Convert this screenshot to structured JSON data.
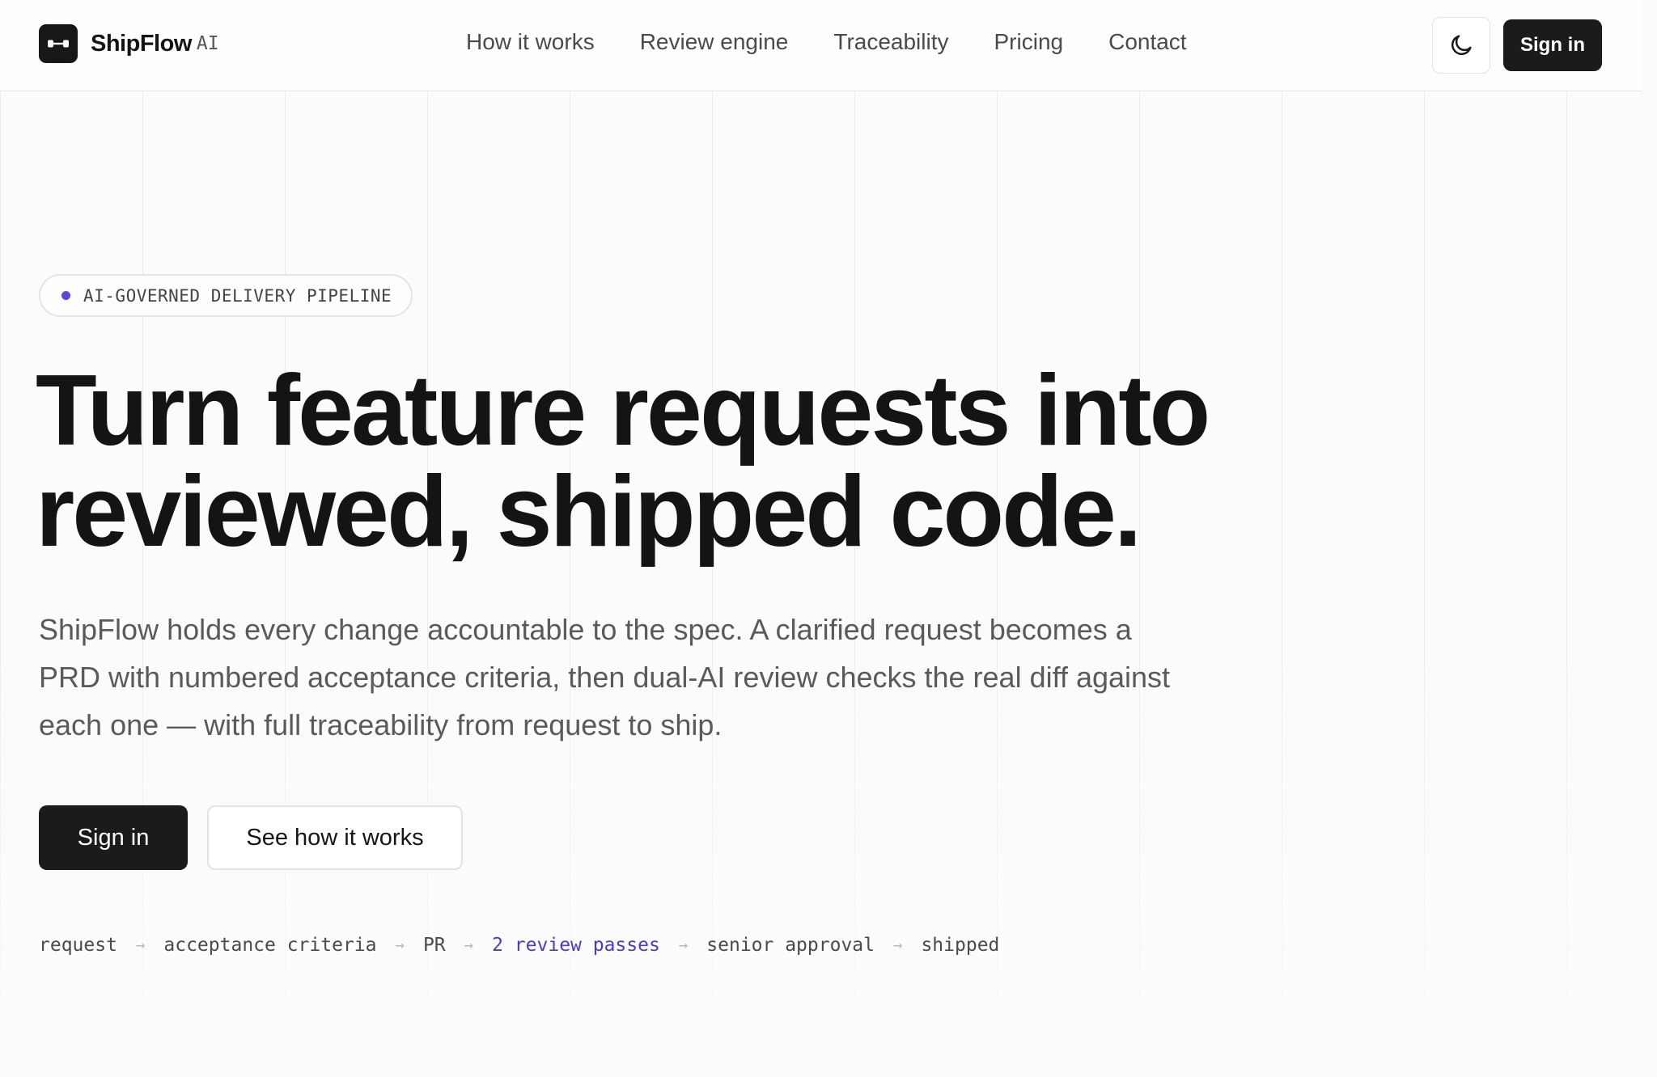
{
  "header": {
    "brand": {
      "name": "ShipFlow",
      "suffix": "AI",
      "logo_icon": "link-icon"
    },
    "nav": [
      {
        "label": "How it works"
      },
      {
        "label": "Review engine"
      },
      {
        "label": "Traceability"
      },
      {
        "label": "Pricing"
      },
      {
        "label": "Contact"
      }
    ],
    "theme_toggle_icon": "moon-icon",
    "sign_in_label": "Sign in"
  },
  "hero": {
    "badge": "AI-GOVERNED DELIVERY PIPELINE",
    "headline_line1": "Turn feature requests into",
    "headline_line2": "reviewed, shipped code.",
    "subtext": "ShipFlow holds every change accountable to the spec. A clarified request becomes a PRD with numbered acceptance criteria, then dual-AI review checks the real diff against each one — with full traceability from request to ship.",
    "primary_cta": "Sign in",
    "secondary_cta": "See how it works",
    "pipeline": [
      {
        "label": "request"
      },
      {
        "label": "acceptance criteria"
      },
      {
        "label": "PR"
      },
      {
        "label": "2 review passes",
        "accent": true
      },
      {
        "label": "senior approval"
      },
      {
        "label": "shipped"
      }
    ]
  },
  "colors": {
    "accent": "#5b47d6",
    "accent_text": "#4a3bc8",
    "dark": "#1b1b1b",
    "background": "#fbfbfb"
  }
}
